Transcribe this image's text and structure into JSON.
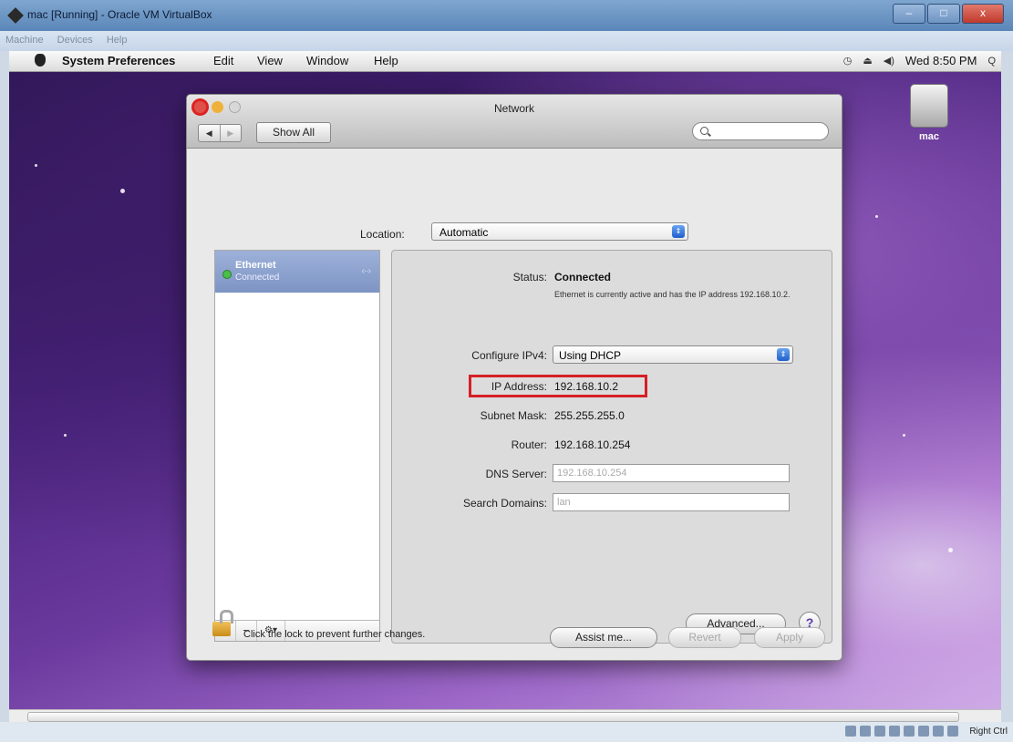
{
  "vbox": {
    "title": "mac [Running] - Oracle VM VirtualBox",
    "menu": [
      "Machine",
      "Devices",
      "Help"
    ],
    "controls": [
      "–",
      "□",
      "x"
    ],
    "host_key": "Right Ctrl"
  },
  "mac_menubar": {
    "app": "System Preferences",
    "items": [
      "Edit",
      "View",
      "Window",
      "Help"
    ],
    "clock": "Wed 8:50 PM"
  },
  "desktop": {
    "drive_label": "mac"
  },
  "window": {
    "title": "Network",
    "show_all": "Show All",
    "nav_back": "◀",
    "nav_forward": "▶",
    "location_label": "Location:",
    "location_value": "Automatic"
  },
  "services": {
    "items": [
      {
        "name": "Ethernet",
        "status": "Connected"
      }
    ],
    "footer": [
      "+",
      "−",
      "⚙▾"
    ]
  },
  "details": {
    "status_label": "Status:",
    "status_value": "Connected",
    "status_desc": "Ethernet is currently active and has the IP address 192.168.10.2.",
    "configure_label": "Configure IPv4:",
    "configure_value": "Using DHCP",
    "ip_label": "IP Address:",
    "ip_value": "192.168.10.2",
    "subnet_label": "Subnet Mask:",
    "subnet_value": "255.255.255.0",
    "router_label": "Router:",
    "router_value": "192.168.10.254",
    "dns_label": "DNS Server:",
    "dns_value": "192.168.10.254",
    "search_label": "Search Domains:",
    "search_value": "lan",
    "advanced": "Advanced...",
    "help": "?"
  },
  "bottom": {
    "lock_text": "Click the lock to prevent further changes.",
    "assist": "Assist me...",
    "revert": "Revert",
    "apply": "Apply"
  },
  "colors": {
    "highlight": "#d51f26",
    "selection": "#7d94c4"
  }
}
